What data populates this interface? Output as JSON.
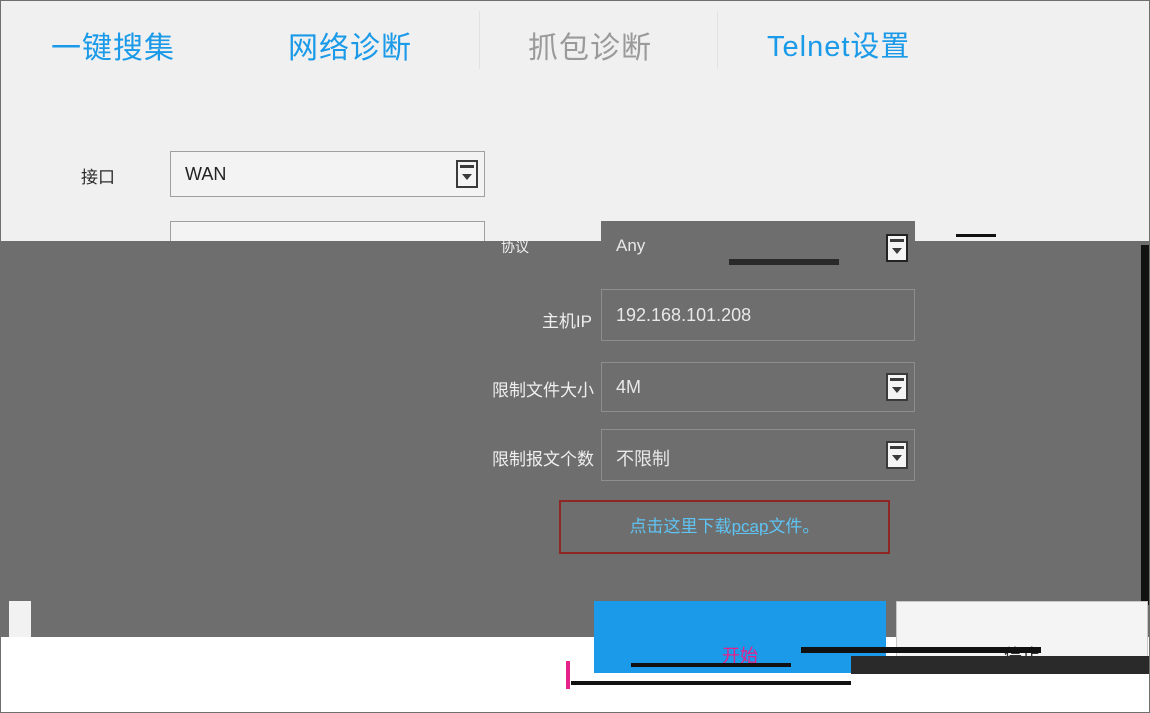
{
  "tabs": [
    {
      "label": "一键搜集",
      "state": "normal"
    },
    {
      "label": "网络诊断",
      "state": "normal"
    },
    {
      "label": "抓包诊断",
      "state": "active-gray"
    },
    {
      "label": "Telnet设置",
      "state": "normal"
    }
  ],
  "form": {
    "interface": {
      "label": "接口",
      "value": "WAN"
    },
    "protocol": {
      "label": "协议",
      "value": "Any"
    },
    "host_ip": {
      "label": "主机IP",
      "value": "192.168.101.208"
    },
    "file_size": {
      "label": "限制文件大小",
      "value": "4M"
    },
    "packet_count": {
      "label": "限制报文个数",
      "value": "不限制"
    }
  },
  "download": {
    "text_before": "点击这里下载",
    "link_text": "pcap",
    "text_after": "文件。"
  },
  "buttons": {
    "start": "开始",
    "stop": "停止"
  },
  "colors": {
    "accent": "#1a9ae8",
    "link": "#5fc4f3",
    "highlight_border": "#8e2626"
  }
}
